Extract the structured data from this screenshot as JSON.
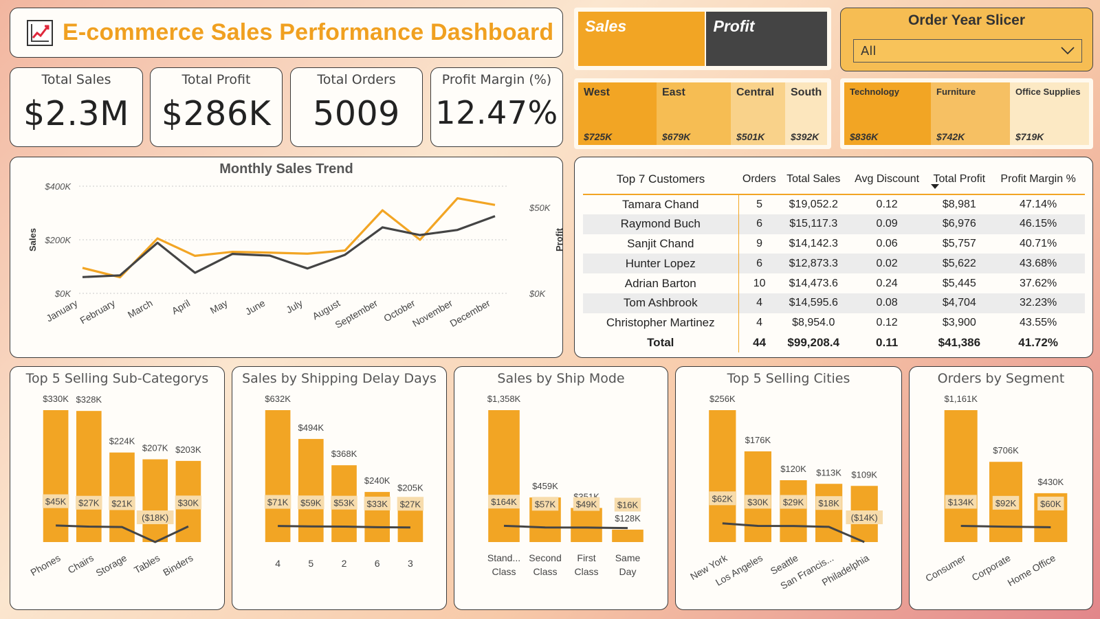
{
  "header": {
    "title": "E-commerce Sales Performance Dashboard",
    "icon": "chart-increasing-icon"
  },
  "kpis": [
    {
      "label": "Total Sales",
      "value": "$2.3M"
    },
    {
      "label": "Total Profit",
      "value": "$286K"
    },
    {
      "label": "Total Orders",
      "value": "5009"
    },
    {
      "label": "Profit Margin (%)",
      "value": "12.47%"
    }
  ],
  "toggle": {
    "sales_label": "Sales",
    "profit_label": "Profit"
  },
  "slicer": {
    "title": "Order Year Slicer",
    "selected": "All"
  },
  "colors": {
    "accent": "#f2a524",
    "dark": "#444444",
    "light_band": "#f6deb0"
  },
  "region_treemap": [
    {
      "name": "West",
      "value": "$725K"
    },
    {
      "name": "East",
      "value": "$679K"
    },
    {
      "name": "Central",
      "value": "$501K"
    },
    {
      "name": "South",
      "value": "$392K"
    }
  ],
  "category_treemap": [
    {
      "name": "Technology",
      "value": "$836K"
    },
    {
      "name": "Furniture",
      "value": "$742K"
    },
    {
      "name": "Office Supplies",
      "value": "$719K"
    }
  ],
  "customers_table": {
    "headers": [
      "Top 7 Customers",
      "Orders",
      "Total Sales",
      "Avg Discount",
      "Total Profit",
      "Profit Margin %"
    ],
    "rows": [
      [
        "Tamara Chand",
        "5",
        "$19,052.2",
        "0.12",
        "$8,981",
        "47.14%"
      ],
      [
        "Raymond Buch",
        "6",
        "$15,117.3",
        "0.09",
        "$6,976",
        "46.15%"
      ],
      [
        "Sanjit Chand",
        "9",
        "$14,142.3",
        "0.06",
        "$5,757",
        "40.71%"
      ],
      [
        "Hunter Lopez",
        "6",
        "$12,873.3",
        "0.02",
        "$5,622",
        "43.68%"
      ],
      [
        "Adrian Barton",
        "10",
        "$14,473.6",
        "0.24",
        "$5,445",
        "37.62%"
      ],
      [
        "Tom Ashbrook",
        "4",
        "$14,595.6",
        "0.08",
        "$4,704",
        "32.23%"
      ],
      [
        "Christopher Martinez",
        "4",
        "$8,954.0",
        "0.12",
        "$3,900",
        "43.55%"
      ]
    ],
    "total": [
      "Total",
      "44",
      "$99,208.4",
      "0.11",
      "$41,386",
      "41.72%"
    ]
  },
  "chart_data": [
    {
      "id": "trend",
      "type": "line",
      "title": "Monthly Sales Trend",
      "xlabel": "",
      "ylabel": "Sales",
      "y2label": "Profit",
      "categories": [
        "January",
        "February",
        "March",
        "April",
        "May",
        "June",
        "July",
        "August",
        "September",
        "October",
        "November",
        "December"
      ],
      "yticks": [
        "$0K",
        "$200K",
        "$400K"
      ],
      "y2ticks": [
        "$0K",
        "$50K"
      ],
      "ylim": [
        0,
        400000
      ],
      "y2lim": [
        0,
        62500
      ],
      "series": [
        {
          "name": "Sales",
          "axis": "left",
          "color": "#f2a524",
          "values": [
            95000,
            60000,
            205000,
            140000,
            155000,
            152000,
            148000,
            160000,
            310000,
            200000,
            355000,
            330000
          ]
        },
        {
          "name": "Profit",
          "axis": "right",
          "color": "#444444",
          "values": [
            9500,
            10500,
            29500,
            12000,
            23000,
            22000,
            14500,
            22500,
            38500,
            34000,
            37000,
            45000
          ]
        }
      ],
      "grid": true
    },
    {
      "id": "subcat",
      "type": "bar",
      "title": "Top 5 Selling Sub-Categorys",
      "categories": [
        "Phones",
        "Chairs",
        "Storage",
        "Tables",
        "Binders"
      ],
      "values": [
        330000,
        328000,
        224000,
        207000,
        203000
      ],
      "labels": [
        "$330K",
        "$328K",
        "$224K",
        "$207K",
        "$203K"
      ],
      "profit": [
        45000,
        27000,
        21000,
        -18000,
        30000
      ],
      "profit_labels": [
        "$45K",
        "$27K",
        "$21K",
        "($18K)",
        "$30K"
      ],
      "rotate_labels": true
    },
    {
      "id": "delay",
      "type": "bar",
      "title": "Sales by Shipping Delay Days",
      "categories": [
        "4",
        "5",
        "2",
        "6",
        "3"
      ],
      "values": [
        632000,
        494000,
        368000,
        240000,
        205000
      ],
      "labels": [
        "$632K",
        "$494K",
        "$368K",
        "$240K",
        "$27K"
      ],
      "profit": [
        71000,
        59000,
        53000,
        33000,
        27000
      ],
      "profit_labels": [
        "$71K",
        "$59K",
        "$53K",
        "$33K",
        "$27K"
      ],
      "top_labels": [
        "$632K",
        "$494K",
        "$368K",
        "$240K",
        "$205K"
      ],
      "rotate_labels": false
    },
    {
      "id": "shipmode",
      "type": "bar",
      "title": "Sales by Ship Mode",
      "categories": [
        "Stand... Class",
        "Second Class",
        "First Class",
        "Same Day"
      ],
      "values": [
        1358000,
        459000,
        351000,
        128000
      ],
      "top_labels": [
        "$1,358K",
        "$459K",
        "$351K",
        "$128K"
      ],
      "profit": [
        164000,
        57000,
        49000,
        16000
      ],
      "profit_labels": [
        "$164K",
        "$57K",
        "$49K",
        "$16K"
      ],
      "rotate_labels": false,
      "wrap_labels": true
    },
    {
      "id": "cities",
      "type": "bar",
      "title": "Top 5 Selling Cities",
      "categories": [
        "New York",
        "Los Angeles",
        "Seattle",
        "San Francis...",
        "Philadelphia"
      ],
      "values": [
        256000,
        176000,
        120000,
        113000,
        109000
      ],
      "top_labels": [
        "$256K",
        "$176K",
        "$120K",
        "$113K",
        "$109K"
      ],
      "profit": [
        62000,
        30000,
        29000,
        18000,
        -14000
      ],
      "profit_labels": [
        "$62K",
        "$30K",
        "$29K",
        "$18K",
        "($14K)"
      ],
      "rotate_labels": true
    },
    {
      "id": "segment",
      "type": "bar",
      "title": "Orders by Segment",
      "categories": [
        "Consumer",
        "Corporate",
        "Home Office"
      ],
      "values": [
        1161000,
        706000,
        430000
      ],
      "top_labels": [
        "$1,161K",
        "$706K",
        "$430K"
      ],
      "profit": [
        134000,
        92000,
        60000
      ],
      "profit_labels": [
        "$134K",
        "$92K",
        "$60K"
      ],
      "rotate_labels": true
    }
  ]
}
